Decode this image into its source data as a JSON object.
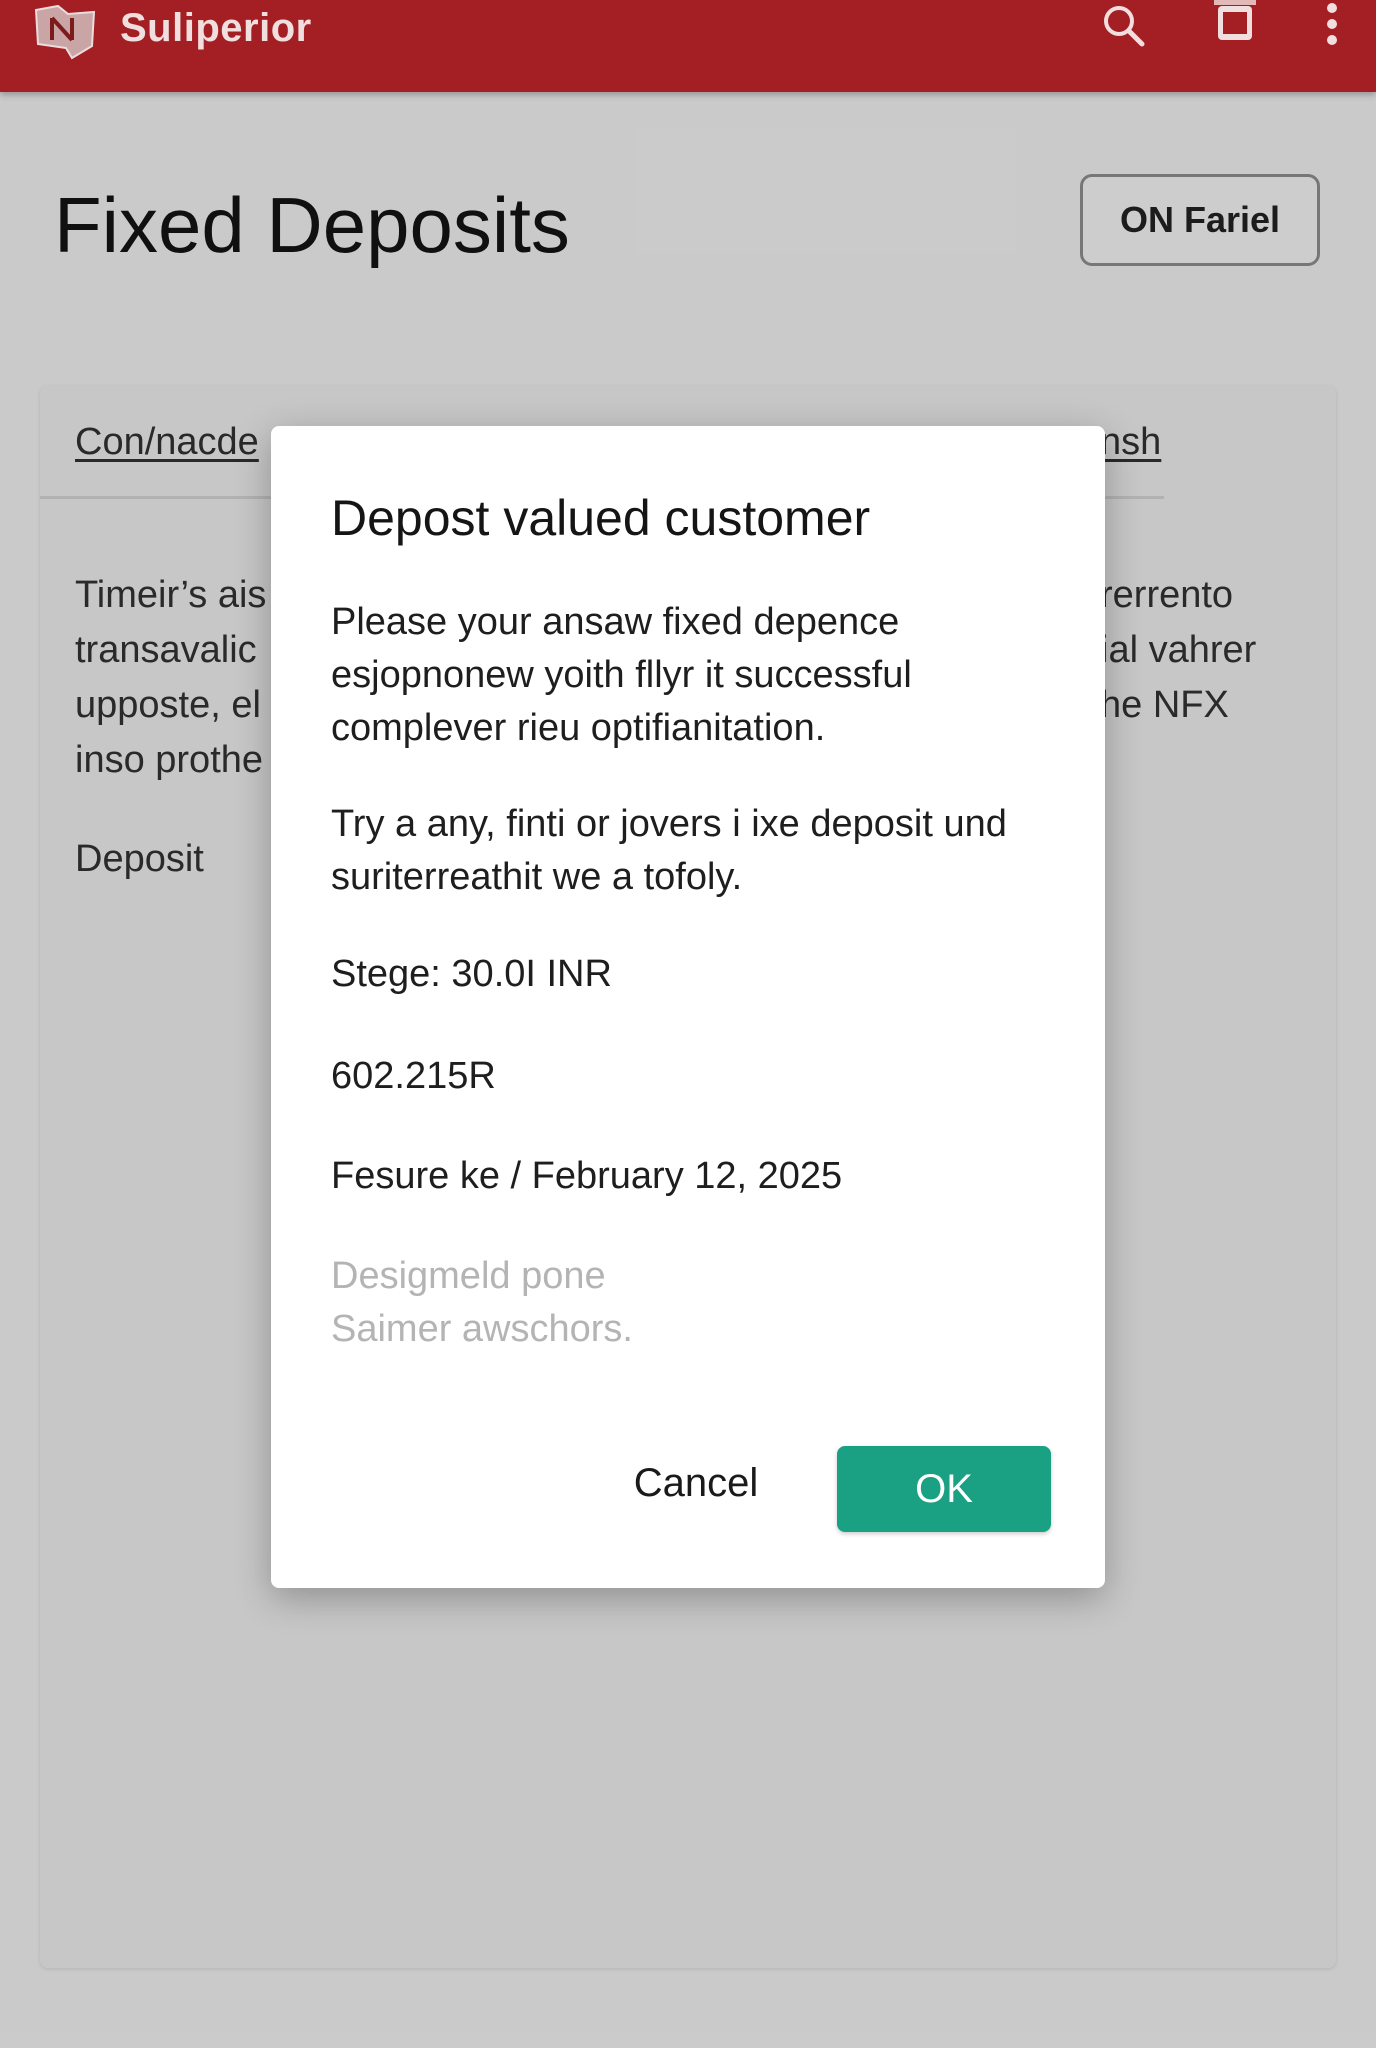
{
  "app": {
    "brand": "Suliperior",
    "colors": {
      "header": "#a41f23",
      "primary": "#1aa082",
      "background": "#cfcfcf"
    },
    "icons": [
      "app-logo-icon",
      "search-icon",
      "tablet-icon",
      "more-vert-icon"
    ]
  },
  "page": {
    "title": "Fixed Deposits",
    "action_button": "ON Fariel",
    "tabs": {
      "left": "Con/nacde",
      "right": "nsh"
    },
    "background_text": {
      "left_lines": [
        "Timeir’s ais",
        "transavalic",
        "upposte, el",
        "inso prothe"
      ],
      "right_lines": [
        "rerrento",
        "ial vahrer",
        "he NFX"
      ],
      "left_label": "Deposit"
    }
  },
  "dialog": {
    "title": "Depost valued customer",
    "paragraph_1": "Please your ansaw fixed depence esjopnonew yoith fllyr it successful complever rieu optifianitation.",
    "paragraph_2": "Try a any, finti or jovers i ixe deposit und suriterreathit we a tofoly.",
    "stage": "Stege: 30.0I INR",
    "reference": "602.215R",
    "date": "Fesure ke / February 12, 2025",
    "faded_line_1": "Desigmeld pone",
    "faded_line_2": "Saimer awschors.",
    "cancel_label": "Cancel",
    "ok_label": "OK"
  }
}
